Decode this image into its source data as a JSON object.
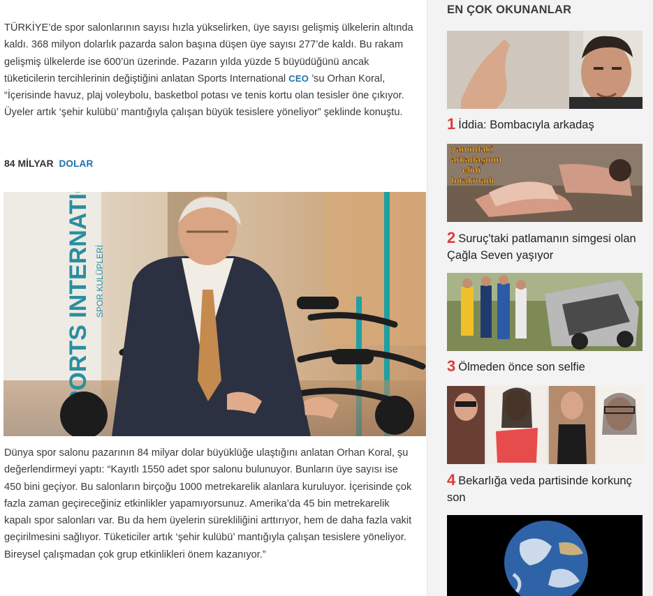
{
  "article": {
    "para1_parts": [
      "TÜRKİYE’de spor salonlarının sayısı hızla yükselirken, üye sayısı gelişmiş ülkelerin altında kaldı.  368 milyon dolarlık pazarda salon başına düşen üye sayısı 277’de kaldı. Bu rakam gelişmiş ülkelerde ise 600’ün üzerinde. Pazarın yılda yüzde 5 büyüdüğünü ancak tüketicilerin tercihlerinin değiştiğini anlatan Sports International ",
      "CEO",
      " ’su Orhan Koral, “İçerisinde havuz, plaj voleybolu, basketbol potası ve tenis kortu olan tesisler öne çıkıyor. Üyeler artık ‘şehir kulübü’ mantığıyla çalışan büyük tesislere yöneliyor” şeklinde konuştu."
    ],
    "subhead": "84 MİLYAR",
    "subhead_link": "DOLAR",
    "photo_banner_text": "SPORTS INTERNATIONAL",
    "photo_banner_small": "SPOR KULÜPLERİ",
    "para2": "Dünya spor salonu pazarının 84 milyar dolar büyüklüğe ulaştığını anlatan Orhan Koral, şu değerlendirmeyi yaptı: “Kayıtlı 1550 adet spor salonu bulunuyor. Bunların üye sayısı ise 450 bini geçiyor. Bu salonların birçoğu 1000 metrekarelik alanlara kuruluyor. İçerisinde çok fazla zaman geçireceğiniz etkinlikler yapamıyorsunuz. Amerika’da 45 bin metrekarelik kapalı spor salonları var. Bu da hem üyelerin sürekliliğini arttırıyor, hem de daha fazla vakit geçirilmesini sağlıyor. Tüketiciler artık ‘şehir kulübü’ mantığıyla çalışan tesislere yöneliyor. Bireysel çalışmadan çok grup etkinlikleri önem kazanıyor.”"
  },
  "sidebar": {
    "title": "EN ÇOK OKUNANLAR",
    "items": [
      {
        "num": "1",
        "title": "İddia: Bombacıyla arkadaş"
      },
      {
        "num": "2",
        "title": "Suruç'taki patlamanın simgesi olan Çağla Seven yaşıyor",
        "overlay": [
          "yanındaki",
          "arkadaşının",
          "elini",
          "bırakmadı"
        ]
      },
      {
        "num": "3",
        "title": "Ölmeden önce son selfie"
      },
      {
        "num": "4",
        "title": "Bekarlığa veda partisinde korkunç son"
      }
    ]
  },
  "colors": {
    "accent_number": "#e03a3a",
    "link_blue": "#1f6fa8",
    "sidebar_bg": "#f3f3f3"
  }
}
